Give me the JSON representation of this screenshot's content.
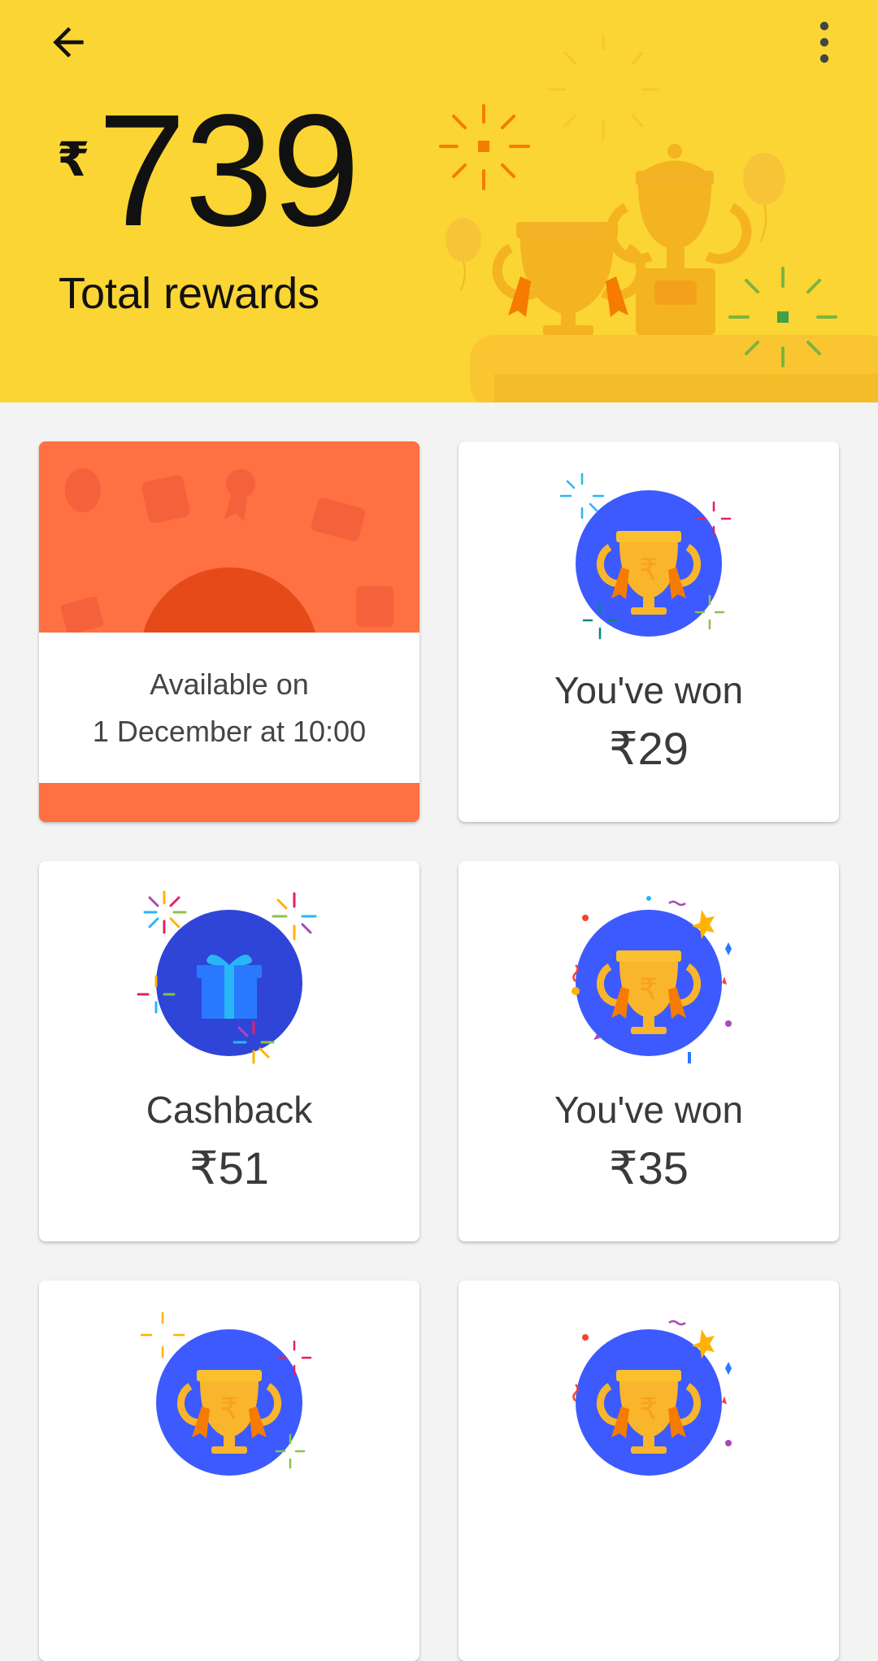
{
  "header": {
    "currency_symbol": "₹",
    "total_amount": "739",
    "total_label": "Total rewards",
    "background_color": "#fbd533"
  },
  "toolbar": {
    "back_icon": "arrow-left-icon",
    "menu_icon": "more-vert-icon"
  },
  "rewards": [
    {
      "type": "locked",
      "line1": "Available on",
      "line2": "1 December at 10:00",
      "accent": "#ff7043"
    },
    {
      "type": "won",
      "title": "You've won",
      "value": "₹29",
      "icon": "trophy-icon"
    },
    {
      "type": "cashback",
      "title": "Cashback",
      "value": "₹51",
      "icon": "gift-icon"
    },
    {
      "type": "won",
      "title": "You've won",
      "value": "₹35",
      "icon": "trophy-icon"
    },
    {
      "type": "won",
      "icon": "trophy-icon"
    },
    {
      "type": "won",
      "icon": "trophy-icon"
    }
  ],
  "colors": {
    "card_circle_blue": "#3d5afe",
    "trophy_gold": "#f9b52b",
    "ribbon_orange": "#f57c00",
    "gift_blue": "#2979ff"
  }
}
